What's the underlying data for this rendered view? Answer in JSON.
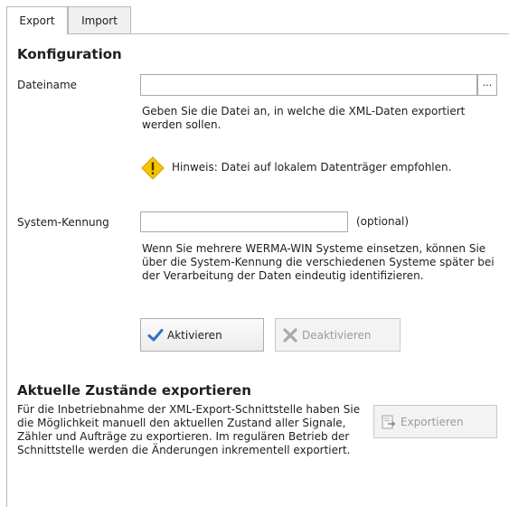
{
  "tabs": [
    {
      "label": "Export",
      "active": true
    },
    {
      "label": "Import",
      "active": false
    }
  ],
  "config": {
    "title": "Konfiguration",
    "filename_label": "Dateiname",
    "filename_value": "",
    "browse_label": "···",
    "filename_help": "Geben Sie die Datei an, in welche die XML-Daten exportiert werden sollen.",
    "hint": "Hinweis: Datei auf lokalem Datenträger empfohlen.",
    "system_label": "System-Kennung",
    "system_value": "",
    "system_optional": "(optional)",
    "system_help": "Wenn Sie mehrere WERMA-WIN Systeme einsetzen, können Sie über die System-Kennung die verschiedenen Systeme später bei der Verarbeitung der Daten eindeutig identifizieren.",
    "activate_label": "Aktivieren",
    "deactivate_label": "Deaktivieren"
  },
  "export_section": {
    "title": "Aktuelle Zustände exportieren",
    "description": "Für die Inbetriebnahme der XML-Export-Schnittstelle haben Sie die Möglichkeit manuell den aktuellen Zustand aller Signale, Zähler und Aufträge zu exportieren. Im regulären Betrieb der Schnittstelle werden die Änderungen inkrementell exportiert.",
    "export_label": "Exportieren"
  },
  "icons": {
    "activate": "checkmark-icon",
    "deactivate": "cross-icon",
    "warning": "warning-icon",
    "export": "export-document-icon"
  },
  "colors": {
    "check_blue": "#2f6fc4",
    "warning_yellow": "#f5c400",
    "border": "#b9b9b9"
  }
}
